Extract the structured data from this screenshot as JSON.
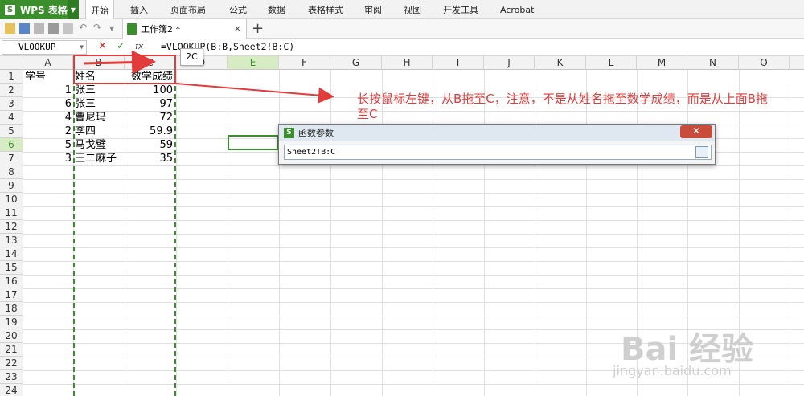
{
  "app": {
    "name": "WPS 表格",
    "logo_letter": "S",
    "brand_color": "#3a8f2c"
  },
  "menu": [
    "开始",
    "插入",
    "页面布局",
    "公式",
    "数据",
    "表格样式",
    "审阅",
    "视图",
    "开发工具",
    "Acrobat"
  ],
  "doc_tab": {
    "label": "工作簿2 *",
    "close": "×",
    "new_tab": "+"
  },
  "formula_bar": {
    "name_box": "VLOOKUP",
    "cancel": "✕",
    "confirm": "✓",
    "fx_label": "fx",
    "formula": "=VLOOKUP(B:B,Sheet2!B:C)"
  },
  "tooltip": "2C",
  "columns": [
    "A",
    "B",
    "C",
    "D",
    "E",
    "F",
    "G",
    "H",
    "I",
    "J",
    "K",
    "L",
    "M",
    "N",
    "O"
  ],
  "rows": [
    "1",
    "2",
    "3",
    "4",
    "5",
    "6",
    "7",
    "8",
    "9",
    "10",
    "11",
    "12",
    "13",
    "14",
    "15",
    "16",
    "17",
    "18",
    "19",
    "20",
    "21",
    "22",
    "23",
    "24"
  ],
  "table": {
    "header": {
      "a": "学号",
      "b": "姓名",
      "c": "数学成绩"
    },
    "data": [
      {
        "a": "1",
        "b": "张三",
        "c": "100"
      },
      {
        "a": "6",
        "b": "张三",
        "c": "97"
      },
      {
        "a": "4",
        "b": "曹尼玛",
        "c": "72"
      },
      {
        "a": "2",
        "b": "李四",
        "c": "59.9"
      },
      {
        "a": "5",
        "b": "马戈璧",
        "c": "59"
      },
      {
        "a": "3",
        "b": "王二麻子",
        "c": "35"
      }
    ]
  },
  "annotation": "长按鼠标左键，从B拖至C，注意，不是从姓名拖至数学成绩，而是从上面B拖至C",
  "dialog": {
    "title": "函数参数",
    "close": "✕",
    "input_value": "Sheet2!B:C"
  },
  "watermark": {
    "brand": "Bai 经验",
    "url": "jingyan.baidu.com"
  }
}
